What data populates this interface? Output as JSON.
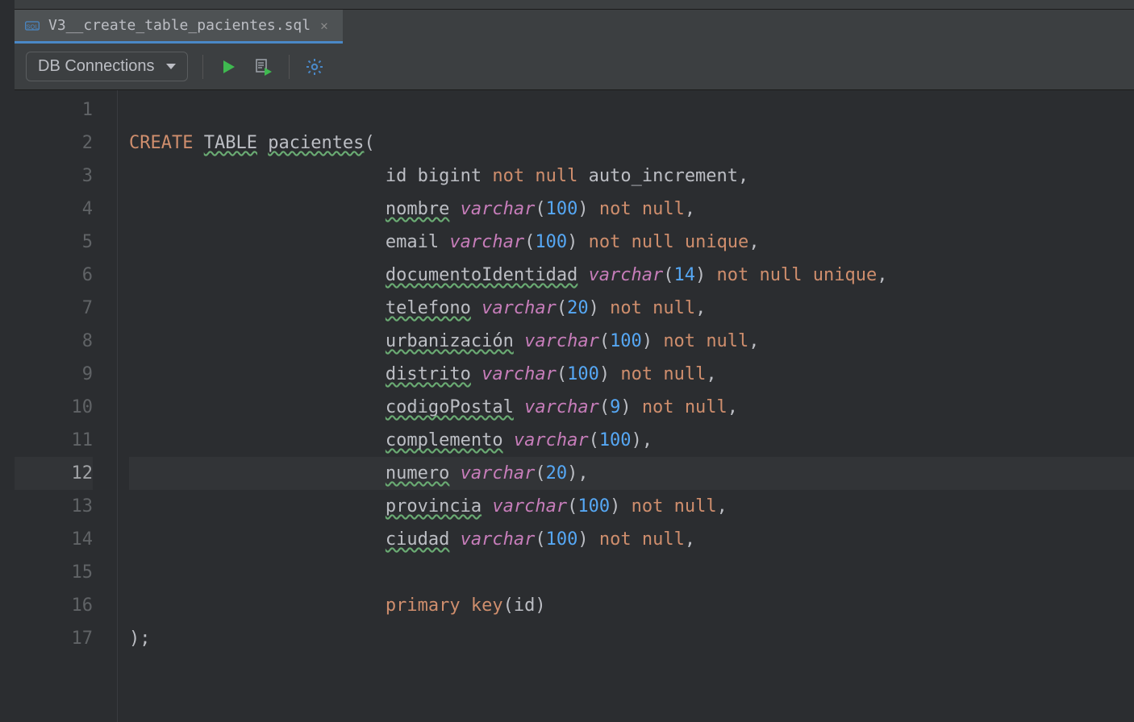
{
  "tab": {
    "filename": "V3__create_table_pacientes.sql",
    "icon": "sql-file-icon",
    "active": true
  },
  "toolbar": {
    "db_connections_label": "DB Connections",
    "run_icon": "run-icon",
    "run_script_icon": "run-script-icon",
    "settings_icon": "gear-icon"
  },
  "editor": {
    "current_line": 12,
    "lines": [
      {
        "n": 1,
        "indent": 0,
        "tokens": []
      },
      {
        "n": 2,
        "indent": 0,
        "tokens": [
          {
            "t": "CREATE",
            "c": "kw"
          },
          {
            "t": " "
          },
          {
            "t": "TABLE",
            "c": "kw ident",
            "typo": true
          },
          {
            "t": " "
          },
          {
            "t": "pacientes",
            "c": "ident",
            "typo": true
          },
          {
            "t": "(",
            "c": "paren"
          }
        ]
      },
      {
        "n": 3,
        "indent": 24,
        "tokens": [
          {
            "t": "id",
            "c": "ident"
          },
          {
            "t": " "
          },
          {
            "t": "bigint",
            "c": "ident"
          },
          {
            "t": " "
          },
          {
            "t": "not",
            "c": "kw"
          },
          {
            "t": " "
          },
          {
            "t": "null",
            "c": "kw"
          },
          {
            "t": " "
          },
          {
            "t": "auto_increment",
            "c": "ident"
          },
          {
            "t": ",",
            "c": "punc"
          }
        ]
      },
      {
        "n": 4,
        "indent": 24,
        "tokens": [
          {
            "t": "nombre",
            "c": "ident",
            "typo": true
          },
          {
            "t": " "
          },
          {
            "t": "varchar",
            "c": "type"
          },
          {
            "t": "(",
            "c": "paren"
          },
          {
            "t": "100",
            "c": "num"
          },
          {
            "t": ")",
            "c": "paren"
          },
          {
            "t": " "
          },
          {
            "t": "not",
            "c": "kw"
          },
          {
            "t": " "
          },
          {
            "t": "null",
            "c": "kw"
          },
          {
            "t": ",",
            "c": "punc"
          }
        ]
      },
      {
        "n": 5,
        "indent": 24,
        "tokens": [
          {
            "t": "email",
            "c": "ident"
          },
          {
            "t": " "
          },
          {
            "t": "varchar",
            "c": "type"
          },
          {
            "t": "(",
            "c": "paren"
          },
          {
            "t": "100",
            "c": "num"
          },
          {
            "t": ")",
            "c": "paren"
          },
          {
            "t": " "
          },
          {
            "t": "not",
            "c": "kw"
          },
          {
            "t": " "
          },
          {
            "t": "null",
            "c": "kw"
          },
          {
            "t": " "
          },
          {
            "t": "unique",
            "c": "kw"
          },
          {
            "t": ",",
            "c": "punc"
          }
        ]
      },
      {
        "n": 6,
        "indent": 24,
        "tokens": [
          {
            "t": "documentoIdentidad",
            "c": "ident",
            "typo": true
          },
          {
            "t": " "
          },
          {
            "t": "varchar",
            "c": "type"
          },
          {
            "t": "(",
            "c": "paren"
          },
          {
            "t": "14",
            "c": "num"
          },
          {
            "t": ")",
            "c": "paren"
          },
          {
            "t": " "
          },
          {
            "t": "not",
            "c": "kw"
          },
          {
            "t": " "
          },
          {
            "t": "null",
            "c": "kw"
          },
          {
            "t": " "
          },
          {
            "t": "unique",
            "c": "kw"
          },
          {
            "t": ",",
            "c": "punc"
          }
        ]
      },
      {
        "n": 7,
        "indent": 24,
        "tokens": [
          {
            "t": "telefono",
            "c": "ident",
            "typo": true
          },
          {
            "t": " "
          },
          {
            "t": "varchar",
            "c": "type"
          },
          {
            "t": "(",
            "c": "paren"
          },
          {
            "t": "20",
            "c": "num"
          },
          {
            "t": ")",
            "c": "paren"
          },
          {
            "t": " "
          },
          {
            "t": "not",
            "c": "kw"
          },
          {
            "t": " "
          },
          {
            "t": "null",
            "c": "kw"
          },
          {
            "t": ",",
            "c": "punc"
          }
        ]
      },
      {
        "n": 8,
        "indent": 24,
        "tokens": [
          {
            "t": "urbanización",
            "c": "ident",
            "typo": true
          },
          {
            "t": " "
          },
          {
            "t": "varchar",
            "c": "type"
          },
          {
            "t": "(",
            "c": "paren"
          },
          {
            "t": "100",
            "c": "num"
          },
          {
            "t": ")",
            "c": "paren"
          },
          {
            "t": " "
          },
          {
            "t": "not",
            "c": "kw"
          },
          {
            "t": " "
          },
          {
            "t": "null",
            "c": "kw"
          },
          {
            "t": ",",
            "c": "punc"
          }
        ]
      },
      {
        "n": 9,
        "indent": 24,
        "tokens": [
          {
            "t": "distrito",
            "c": "ident",
            "typo": true
          },
          {
            "t": " "
          },
          {
            "t": "varchar",
            "c": "type"
          },
          {
            "t": "(",
            "c": "paren"
          },
          {
            "t": "100",
            "c": "num"
          },
          {
            "t": ")",
            "c": "paren"
          },
          {
            "t": " "
          },
          {
            "t": "not",
            "c": "kw"
          },
          {
            "t": " "
          },
          {
            "t": "null",
            "c": "kw"
          },
          {
            "t": ",",
            "c": "punc"
          }
        ]
      },
      {
        "n": 10,
        "indent": 24,
        "tokens": [
          {
            "t": "codigoPostal",
            "c": "ident",
            "typo": true
          },
          {
            "t": " "
          },
          {
            "t": "varchar",
            "c": "type"
          },
          {
            "t": "(",
            "c": "paren"
          },
          {
            "t": "9",
            "c": "num"
          },
          {
            "t": ")",
            "c": "paren"
          },
          {
            "t": " "
          },
          {
            "t": "not",
            "c": "kw"
          },
          {
            "t": " "
          },
          {
            "t": "null",
            "c": "kw"
          },
          {
            "t": ",",
            "c": "punc"
          }
        ]
      },
      {
        "n": 11,
        "indent": 24,
        "tokens": [
          {
            "t": "complemento",
            "c": "ident",
            "typo": true
          },
          {
            "t": " "
          },
          {
            "t": "varchar",
            "c": "type"
          },
          {
            "t": "(",
            "c": "paren"
          },
          {
            "t": "100",
            "c": "num"
          },
          {
            "t": ")",
            "c": "paren"
          },
          {
            "t": ",",
            "c": "punc"
          }
        ]
      },
      {
        "n": 12,
        "indent": 24,
        "tokens": [
          {
            "t": "numero",
            "c": "ident",
            "typo": true
          },
          {
            "t": " "
          },
          {
            "t": "varchar",
            "c": "type"
          },
          {
            "t": "(",
            "c": "paren"
          },
          {
            "t": "20",
            "c": "num"
          },
          {
            "t": ")",
            "c": "paren"
          },
          {
            "t": ",",
            "c": "punc"
          }
        ]
      },
      {
        "n": 13,
        "indent": 24,
        "tokens": [
          {
            "t": "provincia",
            "c": "ident",
            "typo": true
          },
          {
            "t": " "
          },
          {
            "t": "varchar",
            "c": "type"
          },
          {
            "t": "(",
            "c": "paren"
          },
          {
            "t": "100",
            "c": "num"
          },
          {
            "t": ")",
            "c": "paren"
          },
          {
            "t": " "
          },
          {
            "t": "not",
            "c": "kw"
          },
          {
            "t": " "
          },
          {
            "t": "null",
            "c": "kw"
          },
          {
            "t": ",",
            "c": "punc"
          }
        ]
      },
      {
        "n": 14,
        "indent": 24,
        "tokens": [
          {
            "t": "ciudad",
            "c": "ident",
            "typo": true
          },
          {
            "t": " "
          },
          {
            "t": "varchar",
            "c": "type"
          },
          {
            "t": "(",
            "c": "paren"
          },
          {
            "t": "100",
            "c": "num"
          },
          {
            "t": ")",
            "c": "paren"
          },
          {
            "t": " "
          },
          {
            "t": "not",
            "c": "kw"
          },
          {
            "t": " "
          },
          {
            "t": "null",
            "c": "kw"
          },
          {
            "t": ",",
            "c": "punc"
          }
        ]
      },
      {
        "n": 15,
        "indent": 0,
        "tokens": []
      },
      {
        "n": 16,
        "indent": 24,
        "tokens": [
          {
            "t": "primary",
            "c": "kw"
          },
          {
            "t": " "
          },
          {
            "t": "key",
            "c": "kw"
          },
          {
            "t": "(",
            "c": "paren"
          },
          {
            "t": "id",
            "c": "ident"
          },
          {
            "t": ")",
            "c": "paren"
          }
        ]
      },
      {
        "n": 17,
        "indent": 0,
        "tokens": [
          {
            "t": ")",
            "c": "paren"
          },
          {
            "t": ";",
            "c": "punc"
          }
        ]
      }
    ]
  }
}
